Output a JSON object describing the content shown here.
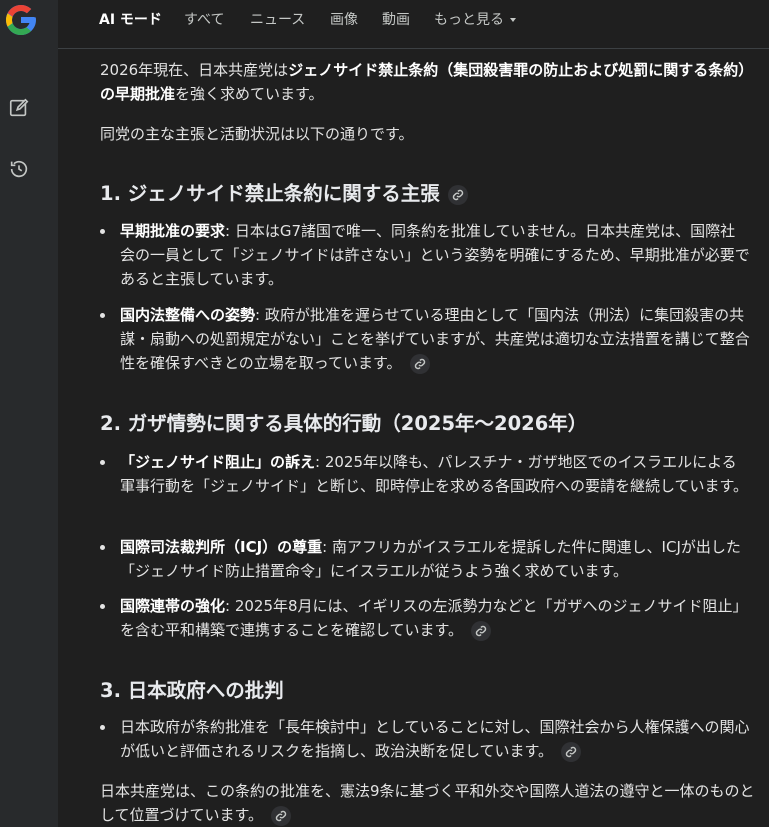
{
  "nav": {
    "tabs": [
      "AI モード",
      "すべて",
      "ニュース",
      "画像",
      "動画",
      "もっと見る"
    ]
  },
  "intro": {
    "t1": "2026年現在、日本共産党は",
    "b1": "ジェノサイド禁止条約（集団殺害罪の防止および処罰に関する条約）の早期批准",
    "t2": "を強く求めています。"
  },
  "intro2": "同党の主な主張と活動状況は以下の通りです。",
  "section1": {
    "heading": "1. ジェノサイド禁止条約に関する主張",
    "items": [
      {
        "bold": "早期批准の要求",
        "text": ": 日本はG7諸国で唯一、同条約を批准していません。日本共産党は、国際社会の一員として「ジェノサイドは許さない」という姿勢を明確にするため、早期批准が必要であると主張しています。"
      },
      {
        "bold": "国内法整備への姿勢",
        "text": ": 政府が批准を遅らせている理由として「国内法（刑法）に集団殺害の共謀・扇動への処罰規定がない」ことを挙げていますが、共産党は適切な立法措置を講じて整合性を確保すべきとの立場を取っています。"
      }
    ]
  },
  "section2": {
    "heading": "2. ガザ情勢に関する具体的行動（2025年〜2026年）",
    "items": [
      {
        "bold": "「ジェノサイド阻止」の訴え",
        "text": ": 2025年以降も、パレスチナ・ガザ地区でのイスラエルによる軍事行動を「ジェノサイド」と断じ、即時停止を求める各国政府への要請を継続しています。"
      },
      {
        "bold": "国際司法裁判所（ICJ）の尊重",
        "text": ": 南アフリカがイスラエルを提訴した件に関連し、ICJが出した「ジェノサイド防止措置命令」にイスラエルが従うよう強く求めています。"
      },
      {
        "bold": "国際連帯の強化",
        "text": ": 2025年8月には、イギリスの左派勢力などと「ガザへのジェノサイド阻止」を含む平和構築で連携することを確認しています。"
      }
    ]
  },
  "section3": {
    "heading": "3. 日本政府への批判",
    "items": [
      {
        "text": "日本政府が条約批准を「長年検討中」としていることに対し、国際社会から人権保護への関心が低いと評価されるリスクを指摘し、政治決断を促しています。"
      }
    ]
  },
  "closing": "日本共産党は、この条約の批准を、憲法9条に基づく平和外交や国際人道法の遵守と一体のものとして位置づけています。",
  "icons": {
    "logo": "google-g-logo",
    "new_chat": "edit-icon",
    "history": "history-icon",
    "link": "link-icon"
  },
  "colors": {
    "background": "#1f1f1f",
    "sidebar": "#282a2c",
    "text": "#e3e3e3",
    "muted": "#c4c7c5"
  }
}
